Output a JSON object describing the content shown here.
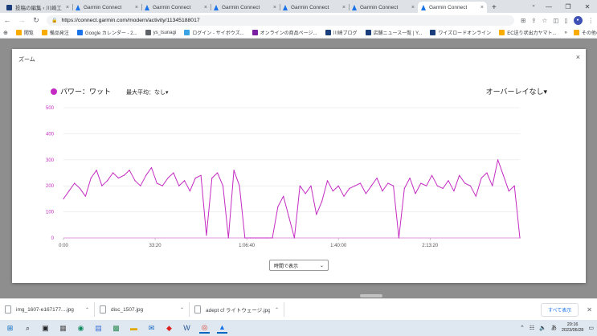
{
  "browser": {
    "tabs": [
      {
        "label": "投稿の編集 ‹ 川崎工 ×",
        "icon": "doc-icon",
        "active": false
      },
      {
        "label": "Garmin Connect",
        "icon": "garmin-icon",
        "active": false
      },
      {
        "label": "Garmin Connect",
        "icon": "garmin-icon",
        "active": false
      },
      {
        "label": "Garmin Connect",
        "icon": "garmin-icon",
        "active": false
      },
      {
        "label": "Garmin Connect",
        "icon": "garmin-icon",
        "active": false
      },
      {
        "label": "Garmin Connect",
        "icon": "garmin-icon",
        "active": false
      },
      {
        "label": "Garmin Connect",
        "icon": "garmin-icon",
        "active": true
      }
    ],
    "new_tab": "+",
    "url": "https://connect.garmin.com/modern/activity/11345188017",
    "bookmarks": [
      {
        "label": "閲覧",
        "color": "#f9ab00"
      },
      {
        "label": "備品発注",
        "color": "#f9ab00"
      },
      {
        "label": "Google カレンダー - 2...",
        "color": "#1a73e8"
      },
      {
        "label": "ys_tsunagi",
        "color": "#5f6368"
      },
      {
        "label": "ログイン - サイボウズ...",
        "color": "#3aa3e3"
      },
      {
        "label": "オンラインの商品ページ...",
        "color": "#7b1fa2"
      },
      {
        "label": "川崎ブログ",
        "color": "#1a3d7c"
      },
      {
        "label": "店舗ニュース一覧 | Y...",
        "color": "#1a3d7c"
      },
      {
        "label": "ワイズロードオンライン",
        "color": "#1a3d7c"
      },
      {
        "label": "EC送り状出力ヤマト...",
        "color": "#f9ab00"
      }
    ],
    "bookmarks_more": "»",
    "other_bookmarks": "その他のブックマーク"
  },
  "modal": {
    "title": "ズーム",
    "close": "×",
    "legend_label": "パワー：ワット",
    "avg_label": "最大平均：なし▾",
    "overlay_label": "オーバーレイなし▾",
    "time_select": "時間で表示"
  },
  "chart_data": {
    "type": "line",
    "title": "",
    "series": [
      {
        "name": "パワー：ワット",
        "color": "#c42bc2"
      }
    ],
    "ylim": [
      0,
      500
    ],
    "yticks": [
      "0",
      "100",
      "200",
      "300",
      "400",
      "500"
    ],
    "xticks": [
      "0:00",
      "33:20",
      "1:06:40",
      "1:40:00",
      "2:13:20"
    ],
    "xlim_seconds": [
      0,
      9960
    ],
    "grid": true,
    "samples_seconds": [
      0,
      120,
      240,
      360,
      480,
      600,
      720,
      840,
      960,
      1080,
      1200,
      1320,
      1440,
      1560,
      1680,
      1800,
      1920,
      2040,
      2160,
      2280,
      2400,
      2520,
      2640,
      2760,
      2880,
      3000,
      3120,
      3240,
      3360,
      3480,
      3600,
      3720,
      3840,
      3960,
      4080,
      4200,
      4320,
      4440,
      4560,
      4680,
      4800,
      4920,
      5040,
      5160,
      5280,
      5400,
      5520,
      5640,
      5760,
      5880,
      6000,
      6120,
      6240,
      6360,
      6480,
      6600,
      6720,
      6840,
      6960,
      7080,
      7200,
      7320,
      7440,
      7560,
      7680,
      7800,
      7920,
      8040,
      8160,
      8280,
      8400,
      8520,
      8640,
      8760,
      8880,
      9000,
      9120,
      9240,
      9360,
      9480,
      9600,
      9720,
      9840,
      9960
    ],
    "power_watts": [
      150,
      180,
      210,
      190,
      160,
      230,
      260,
      200,
      220,
      250,
      230,
      240,
      260,
      220,
      200,
      240,
      270,
      210,
      200,
      230,
      250,
      200,
      220,
      180,
      230,
      240,
      10,
      230,
      250,
      200,
      0,
      260,
      200,
      0,
      0,
      0,
      0,
      0,
      0,
      120,
      160,
      80,
      0,
      200,
      170,
      200,
      90,
      140,
      220,
      180,
      200,
      160,
      190,
      200,
      210,
      170,
      200,
      230,
      180,
      210,
      200,
      0,
      190,
      230,
      170,
      210,
      200,
      240,
      200,
      190,
      220,
      180,
      240,
      210,
      200,
      160,
      230,
      250,
      200,
      300,
      240,
      180,
      200,
      0
    ]
  },
  "downloads": [
    {
      "name": "img_1607-e167177....jpg"
    },
    {
      "name": "disc_1507.jpg"
    },
    {
      "name": "adept cf ライトウェージ.jpg"
    }
  ],
  "downloads_show_all": "すべて表示",
  "taskbar": {
    "time": "20:16",
    "date": "2023/06/28",
    "ime": "あ"
  }
}
